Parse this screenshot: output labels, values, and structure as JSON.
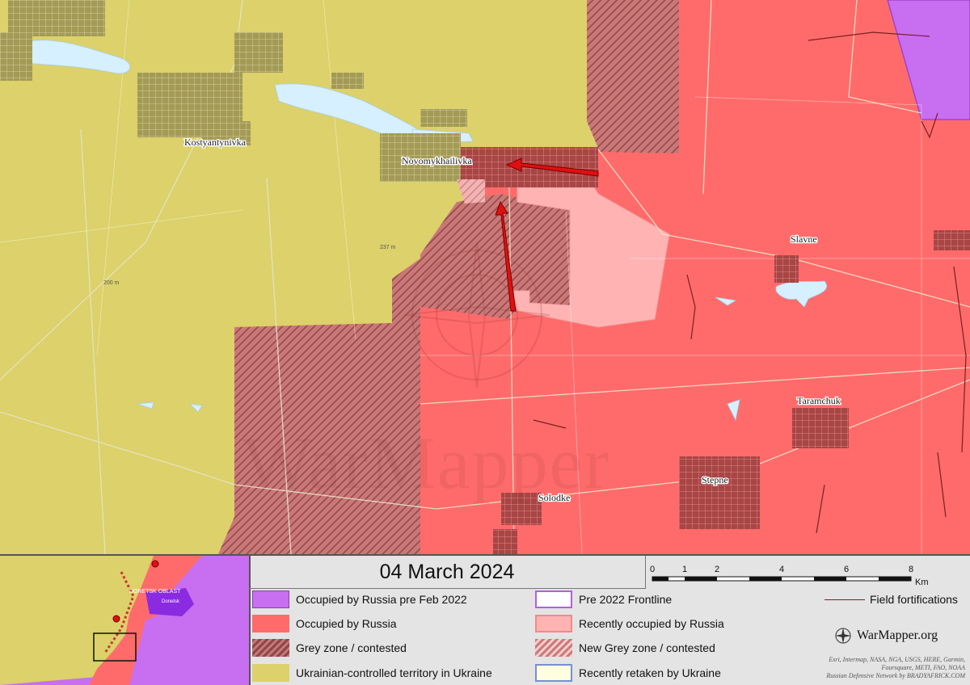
{
  "map": {
    "places": [
      "Kostyantynivka",
      "Novomykhailivka",
      "Slavne",
      "Taramchuk",
      "Stepne",
      "Solodke"
    ],
    "elevations": [
      "200 m",
      "237 m"
    ],
    "watermark": "WarMapper"
  },
  "colors": {
    "occupied_pre2022": "#c86ef0",
    "occupied": "#ff6b6b",
    "grey_zone": "#a86a6a",
    "ukraine": "#dcd16a",
    "recently_occupied": "#ffb3b3",
    "recently_retaken": "#ffffe0",
    "water": "#d6f0ff",
    "arrow": "#e01010"
  },
  "legend": {
    "date": "04 March 2024",
    "items": [
      {
        "label": "Occupied by Russia pre Feb 2022"
      },
      {
        "label": "Pre 2022 Frontline"
      },
      {
        "label": "Occupied by Russia"
      },
      {
        "label": "Recently occupied by Russia"
      },
      {
        "label": "Grey zone / contested"
      },
      {
        "label": "New Grey zone / contested"
      },
      {
        "label": "Ukrainian-controlled territory in Ukraine"
      },
      {
        "label": "Recently retaken by Ukraine"
      }
    ],
    "field_fortifications": "Field fortifications",
    "scale_ticks": [
      "0",
      "1",
      "2",
      "4",
      "6",
      "8"
    ],
    "scale_unit": "Km",
    "brand": "WarMapper.org",
    "credits": [
      "Esri, Intermap, NASA, NGA, USGS, HERE, Garmin,",
      "Foursquare, METI, FAO, NOAA",
      "Russian Defensive Network by BRADYAFRICK.COM"
    ]
  },
  "inset": {
    "labels": [
      "DONETSK OBLAST",
      "Donetsk"
    ]
  }
}
